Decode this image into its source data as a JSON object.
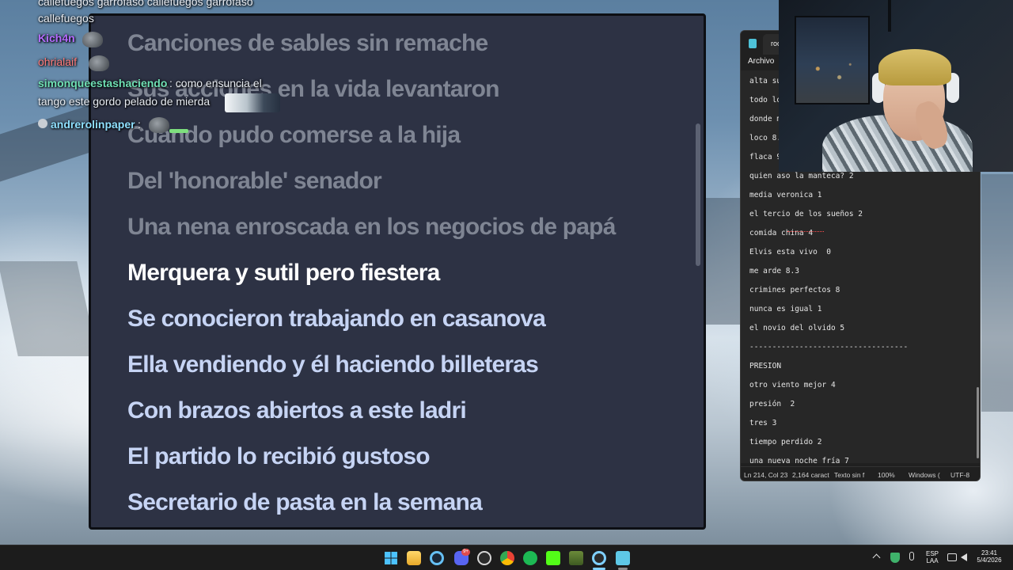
{
  "chat": {
    "top_partial": "callefuegos garrofaso callefuegos garrofaso",
    "messages": [
      {
        "user": "callefuegos",
        "text": ""
      },
      {
        "user": "Kich4n",
        "text": ""
      },
      {
        "user": "ohrialaif",
        "text": ""
      },
      {
        "user": "simonqueestashaciendo",
        "text": ": como ensuncia el"
      },
      {
        "user": "",
        "text": "tango este gordo pelado de mierda"
      },
      {
        "user": "andrerolinpaper",
        "text": ":"
      }
    ],
    "colors": {
      "kich4n": "#b46bff",
      "ohrialaif": "#ff7a7a",
      "simon": "#6fe0b4",
      "andre": "#8fe0ff"
    }
  },
  "lyrics": {
    "lines": [
      "Canciones de sables sin remache",
      "Sus acciones en la vida levantaron",
      "Cuando pudo comerse a la hija",
      "Del 'honorable' senador",
      "Una nena enroscada en los negocios de papá",
      "Merquera y sutil pero fiestera",
      "Se conocieron trabajando en casanova",
      "Ella vendiendo y él haciendo billeteras",
      "Con brazos abiertos a este ladri",
      "El partido lo recibió gustoso",
      "Secretario de pasta en la semana"
    ],
    "current_index": 5
  },
  "notepad": {
    "tab_title": "roc",
    "menu_file": "Archivo",
    "lines": [
      "alta su",
      "todo lo",
      "donde m",
      "loco 8.",
      "flaca 9",
      "quien aso la manteca? 2",
      "media veronica 1",
      "el tercio de los sueños 2",
      "comida china 4",
      "Elvis esta vivo  0",
      "me arde 8.3",
      "crimines perfectos 8",
      "nunca es igual 1",
      "el novio del olvido 5",
      "-----------------------------------",
      "PRESION",
      "otro viento mejor 4",
      "presión  2",
      "tres 3",
      "tiempo perdido 2",
      "una nueva noche fría 7"
    ],
    "status": {
      "position": "Ln 214, Col 23",
      "chars": "2,164 caract",
      "format": "Texto sin f",
      "zoom": "100%",
      "eol": "Windows (",
      "encoding": "UTF-8"
    }
  },
  "taskbar": {
    "apps": [
      "start-icon",
      "file-explorer-icon",
      "steam-icon",
      "discord-icon",
      "obs-icon",
      "chrome-icon",
      "spotify-icon",
      "kick-icon",
      "game-icon",
      "refresh-app-icon",
      "notepad-icon"
    ],
    "discord_badge": "9+",
    "tray": {
      "lang_top": "ESP",
      "lang_bottom": "LAA",
      "time": "23:41",
      "date": "5/4/2026"
    }
  }
}
